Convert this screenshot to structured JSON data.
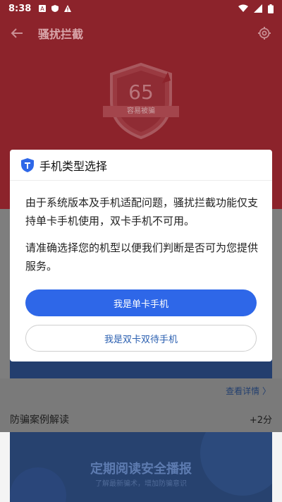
{
  "status_bar": {
    "time": "8:38"
  },
  "header": {
    "title": "骚扰拦截"
  },
  "shield": {
    "score": "65",
    "label": "容易被骗"
  },
  "details_link": "查看详情 〉",
  "case_section": {
    "title": "防骗案例解读",
    "points": "+2分"
  },
  "banner": {
    "title": "定期阅读安全播报",
    "subtitle": "了解最新骗术，增加防骗意识"
  },
  "dialog": {
    "title": "手机类型选择",
    "paragraph1": "由于系统版本及手机适配问题，骚扰拦截功能仅支持单卡手机使用，双卡手机不可用。",
    "paragraph2": "请准确选择您的机型以便我们判断是否可为您提供服务。",
    "primary_button": "我是单卡手机",
    "secondary_button": "我是双卡双待手机"
  },
  "colors": {
    "header_red": "#8c232b",
    "primary_blue": "#2e67e8",
    "banner_blue": "#27426f"
  }
}
